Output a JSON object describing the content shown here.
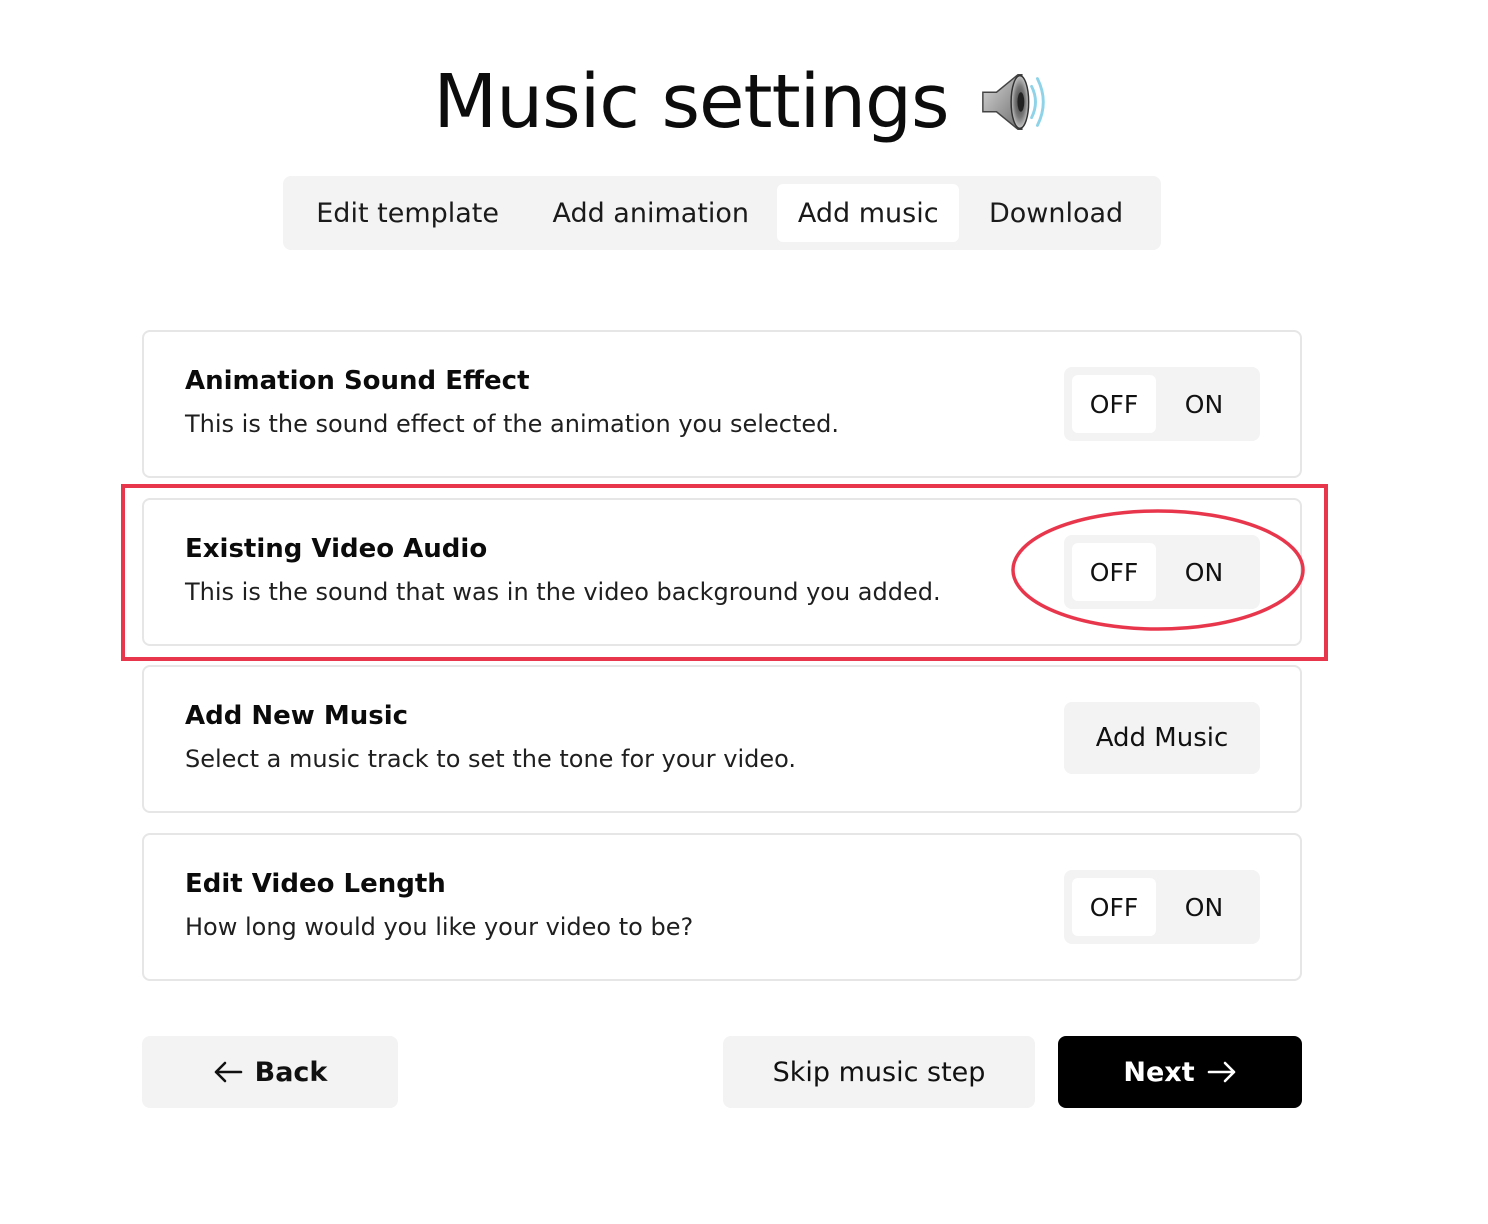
{
  "header": {
    "title": "Music settings",
    "title_icon": "speaker-icon"
  },
  "tabs": [
    {
      "label": "Edit template",
      "active": false
    },
    {
      "label": "Add animation",
      "active": false
    },
    {
      "label": "Add music",
      "active": true
    },
    {
      "label": "Download",
      "active": false
    }
  ],
  "settings": [
    {
      "title": "Animation Sound Effect",
      "description": "This is the sound effect of the animation you selected.",
      "off_label": "OFF",
      "on_label": "ON",
      "selected": "OFF"
    },
    {
      "title": "Existing Video Audio",
      "description": "This is the sound that was in the video background you added.",
      "off_label": "OFF",
      "on_label": "ON",
      "selected": "OFF",
      "highlighted": true
    },
    {
      "title": "Add New Music",
      "description": "Select a music track to set the tone for your video.",
      "button_label": "Add Music"
    },
    {
      "title": "Edit Video Length",
      "description": "How long would you like your video to be?",
      "off_label": "OFF",
      "on_label": "ON",
      "selected": "OFF"
    }
  ],
  "footer": {
    "back_label": "Back",
    "skip_label": "Skip music step",
    "next_label": "Next"
  },
  "colors": {
    "annotation_red": "#e8374d",
    "primary_button": "#000000",
    "muted_bg": "#f3f3f3"
  }
}
